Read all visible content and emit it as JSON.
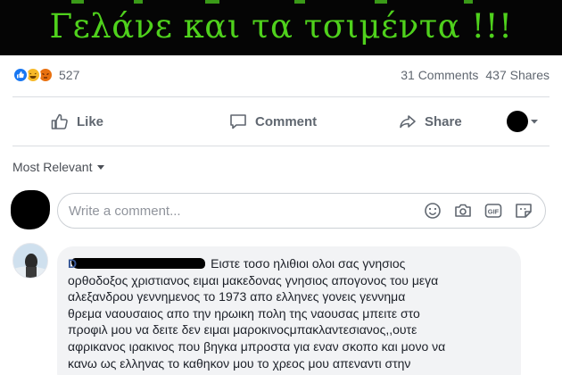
{
  "banner": {
    "title": "Γελάνε και τα τσιμέντα !!!"
  },
  "post_stats": {
    "reactions": [
      "like-icon",
      "haha-icon",
      "angry-icon"
    ],
    "reaction_count": "527",
    "comments": "31 Comments",
    "shares": "437 Shares"
  },
  "actions": {
    "like": "Like",
    "comment": "Comment",
    "share": "Share"
  },
  "sort": {
    "label": "Most Relevant"
  },
  "composer": {
    "placeholder": "Write a comment...",
    "icons": [
      "emoji-icon",
      "camera-icon",
      "gif-icon",
      "sticker-icon"
    ]
  },
  "comment": {
    "author_visible": "D",
    "lines": [
      "Ειστε τοσο ηλιθιοι ολοι σας γνησιος",
      "ορθοδοξος χριστιανος ειμαι μακεδονας γνησιος απογονος του μεγα",
      "αλεξανδρου γεννημενος το 1973 απο ελληνες γονεις γεννημα",
      "θρεμα ναουσαιος απο την ηρωικη πολη της ναουσας μπειτε στο",
      "προφιλ μου να δειτε δεν ειμαι μαροκινοςμπακλαντεσιανος,,ουτε",
      "αφρικανος ιρακινος που βηγκα μπροστα για εναν σκοπο και μονο να",
      "κανω ως ελληνας το καθηκον μου το χρεος μου απεναντι στην"
    ]
  },
  "colors": {
    "banner_bg": "#050505",
    "banner_text": "#4fd11c",
    "link_blue": "#385898",
    "muted": "#606770"
  }
}
